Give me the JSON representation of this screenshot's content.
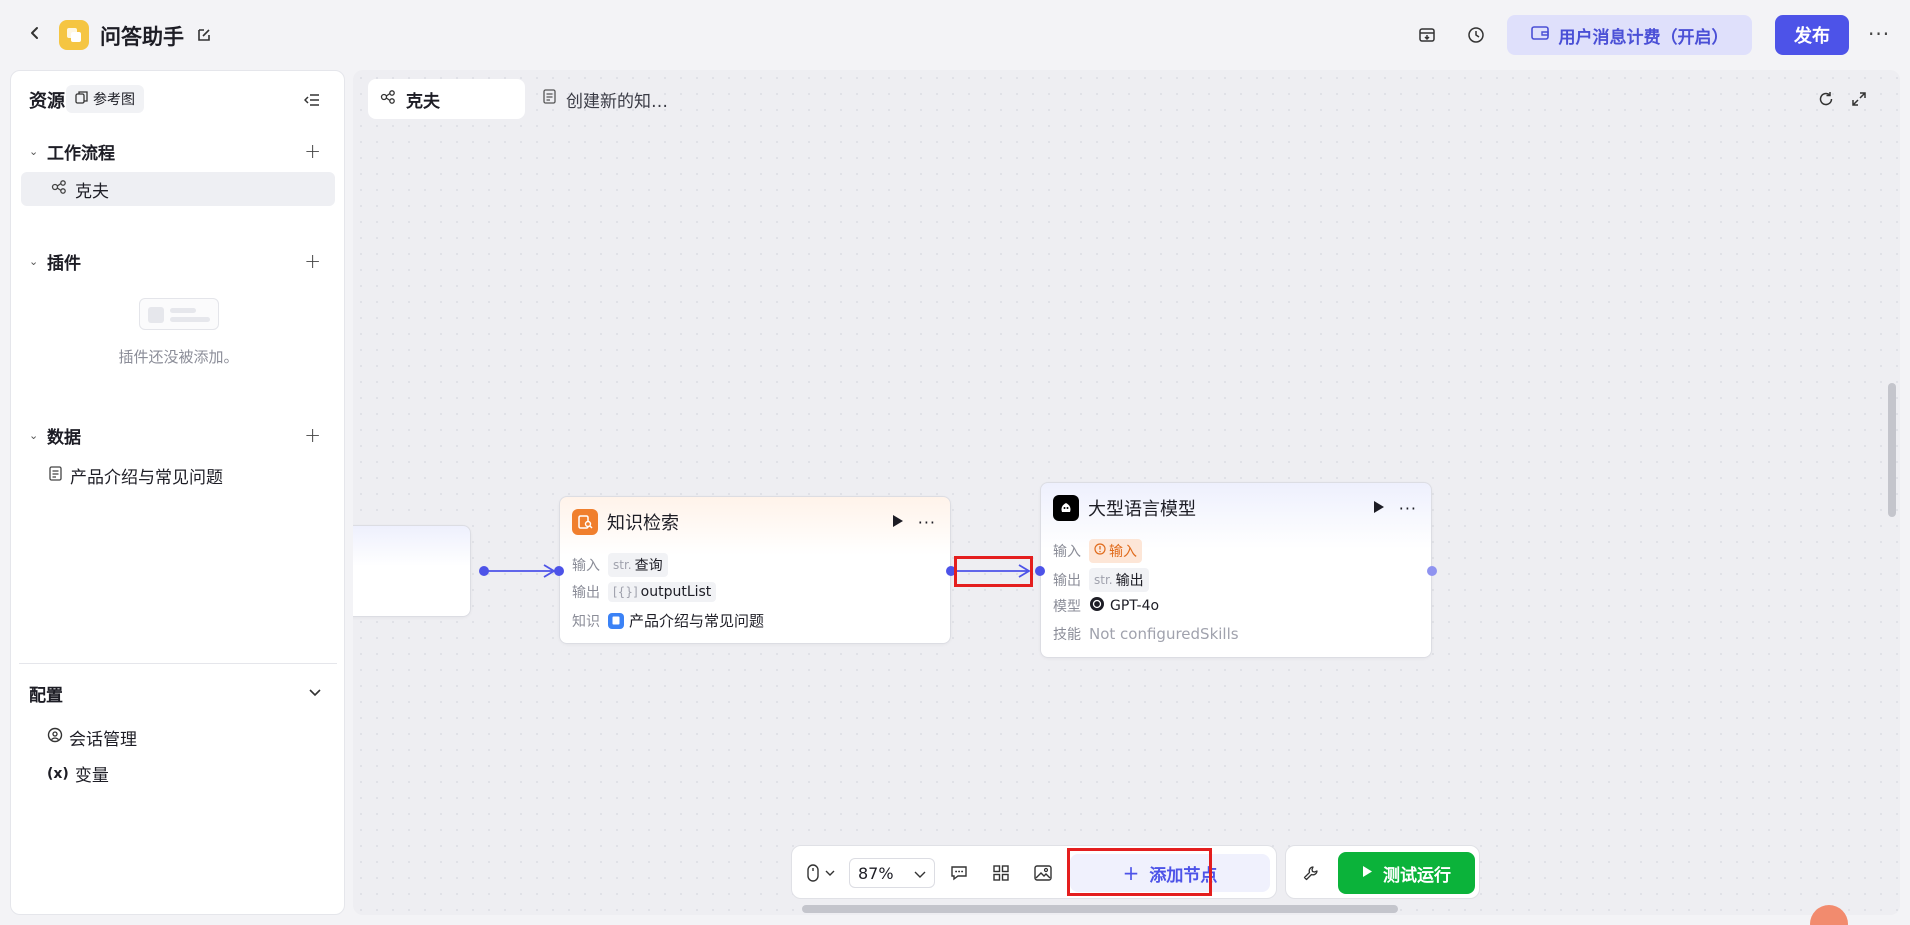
{
  "header": {
    "app_title": "问答助手",
    "billing_label": "用户消息计费（开启）",
    "publish_label": "发布",
    "more_label": "···"
  },
  "sidebar": {
    "title": "资源",
    "reference_label": "参考图",
    "workflow": {
      "title": "工作流程",
      "items": [
        {
          "label": "克夫"
        }
      ]
    },
    "plugins": {
      "title": "插件",
      "empty_text": "插件还没被添加。"
    },
    "data": {
      "title": "数据",
      "items": [
        {
          "label": "产品介绍与常见问题"
        }
      ]
    },
    "config": {
      "title": "配置",
      "items": [
        {
          "label": "会话管理"
        },
        {
          "label": "变量"
        }
      ],
      "variable_icon_text": "(x)"
    }
  },
  "canvas": {
    "tabs": [
      {
        "label": "克夫"
      },
      {
        "label": "创建新的知…"
      }
    ],
    "nodes": {
      "knowledge_retrieval": {
        "title": "知识检索",
        "input_key": "输入",
        "input_type": "str.",
        "input_value": "查询",
        "output_key": "输出",
        "output_type": "[{}]",
        "output_value": "outputList",
        "knowledge_key": "知识",
        "knowledge_value": "产品介绍与常见问题"
      },
      "llm": {
        "title": "大型语言模型",
        "input_key": "输入",
        "input_value": "输入",
        "output_key": "输出",
        "output_type": "str.",
        "output_value": "输出",
        "model_key": "模型",
        "model_value": "GPT-4o",
        "skills_key": "技能",
        "skills_value": "Not configuredSkills"
      }
    }
  },
  "toolbar": {
    "zoom_value": "87%",
    "add_node_label": "添加节点",
    "test_run_label": "测试运行"
  },
  "colors": {
    "accent": "#4d53e8",
    "run_green": "#0bb33a",
    "highlight_red": "#e41e1e",
    "app_icon": "#f5c542",
    "kr_icon": "#f07f2d"
  },
  "icons": [
    "back-icon",
    "edit-icon",
    "archive-icon",
    "history-icon",
    "wallet-icon",
    "reference-icon",
    "collapse-icon",
    "workflow-icon",
    "document-icon",
    "session-icon",
    "refresh-icon",
    "fullscreen-icon",
    "play-icon",
    "mouse-icon",
    "comment-icon",
    "layout-icon",
    "image-icon",
    "note-icon",
    "plus-icon",
    "wrench-icon",
    "openai-icon"
  ]
}
